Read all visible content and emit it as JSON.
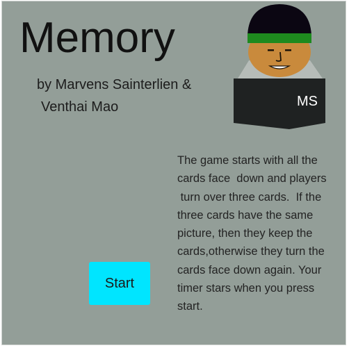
{
  "game": {
    "title": "Memory",
    "byline": [
      "by Marvens Sainterlien &",
      "Venthai Mao"
    ],
    "avatar": {
      "badge_text": "MS",
      "colors": {
        "cap": "#0b0612",
        "cap_band": "#1e8a1e",
        "skin": "#c98a3c",
        "collar": "#b6bcb8",
        "shirt": "#1f2222",
        "badge_text": "#ffffff"
      }
    },
    "description_lines": [
      "The game starts with all the",
      "cards face  down and players",
      " turn over three cards.  If the",
      "three cards have the same",
      "picture, then they keep the",
      "cards,otherwise they turn the",
      "cards face down again. Your",
      "timer stars when you press",
      "start."
    ],
    "start_label": "Start"
  },
  "colors": {
    "background": "#939e98",
    "start_button": "#00e5ff"
  }
}
